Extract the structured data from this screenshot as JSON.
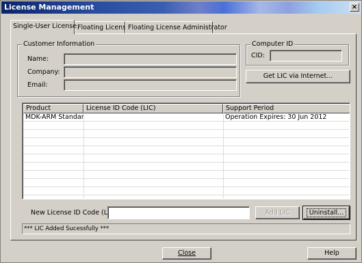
{
  "window": {
    "title": "License Management",
    "close_glyph": "×"
  },
  "tabs": [
    {
      "label": "Single-User License",
      "active": true
    },
    {
      "label": "Floating License",
      "active": false
    },
    {
      "label": "Floating License Administrator",
      "active": false
    }
  ],
  "customer": {
    "legend": "Customer Information",
    "name_label": "Name:",
    "company_label": "Company:",
    "email_label": "Email:",
    "name_value": "",
    "company_value": "",
    "email_value": ""
  },
  "computer": {
    "legend": "Computer ID",
    "cid_label": "CID:",
    "cid_value": ""
  },
  "buttons": {
    "get_lic": "Get LIC via Internet...",
    "add_lic": "Add LIC",
    "uninstall": "Uninstall...",
    "close": "Close",
    "help": "Help"
  },
  "table": {
    "columns": [
      "Product",
      "License ID Code (LIC)",
      "Support Period"
    ],
    "rows": [
      [
        "MDK-ARM Standard",
        "",
        "Operation Expires: 30 Jun 2012"
      ]
    ]
  },
  "new_lic": {
    "label": "New License ID Code (LIC):",
    "value": ""
  },
  "status_text": "*** LIC Added Sucessfully ***"
}
